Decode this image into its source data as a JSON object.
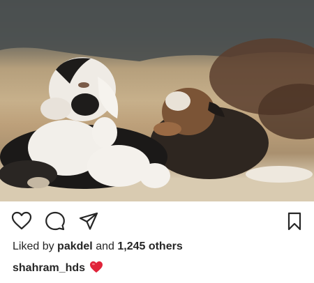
{
  "post": {
    "photo_label": "goat kids resting",
    "actions": {
      "like_icon": "heart-outline-icon",
      "comment_icon": "comment-bubble-icon",
      "share_icon": "paper-plane-icon",
      "save_icon": "bookmark-icon"
    },
    "likes": {
      "prefix": "Liked by",
      "user": "pakdel",
      "middle": "and",
      "count": "1,245 others"
    },
    "caption": {
      "username": "shahram_hds",
      "emoji_icon": "red-heart-emoji"
    }
  }
}
